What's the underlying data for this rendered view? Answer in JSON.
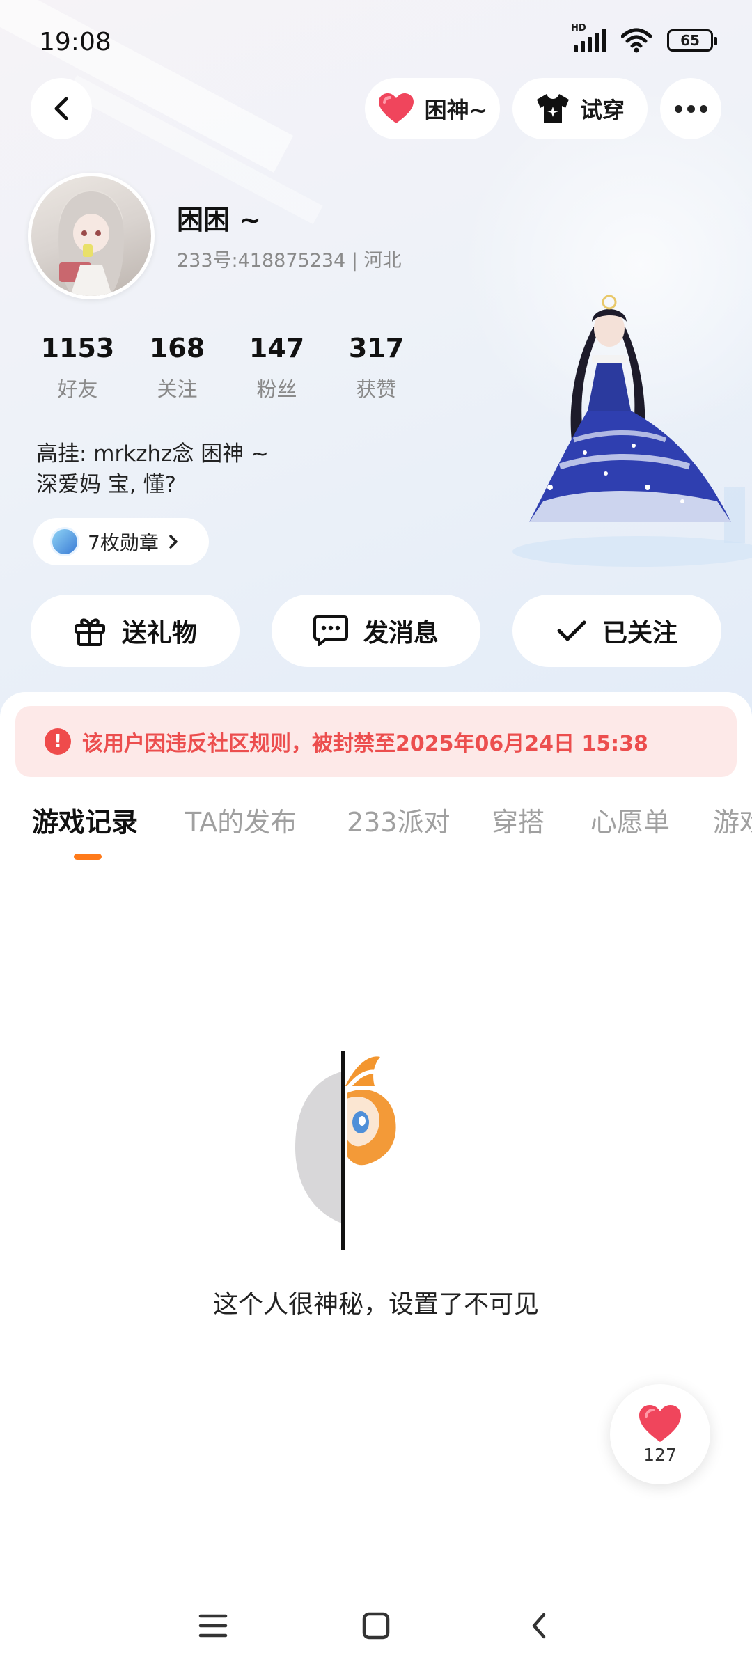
{
  "status_bar": {
    "time": "19:08",
    "signal_label": "HD",
    "battery": "65"
  },
  "top_actions": {
    "like_label": "困神~",
    "tryon_label": "试穿"
  },
  "profile": {
    "name": "困困 ~",
    "id_line": "233号:418875234 | 河北",
    "stats": [
      {
        "value": "1153",
        "label": "好友"
      },
      {
        "value": "168",
        "label": "关注"
      },
      {
        "value": "147",
        "label": "粉丝"
      },
      {
        "value": "317",
        "label": "获赞"
      }
    ],
    "bio_line1": "高挂: mrkzhz念  困神 ~",
    "bio_line2": "深爱妈 宝, 懂?",
    "badge_label": "7枚勋章"
  },
  "actions": {
    "gift": "送礼物",
    "message": "发消息",
    "followed": "已关注"
  },
  "ban_notice": "该用户因违反社区规则，被封禁至2025年06月24日 15:38",
  "tabs": [
    "游戏记录",
    "TA的发布",
    "233派对",
    "穿搭",
    "心愿单",
    "游戏"
  ],
  "empty_state": "这个人很神秘，设置了不可见",
  "float_like": {
    "count": "127"
  },
  "colors": {
    "accent": "#ff7a1a",
    "ban_text": "#ec4e4e",
    "ban_bg": "#fde9e8",
    "heart": "#f0455c"
  }
}
